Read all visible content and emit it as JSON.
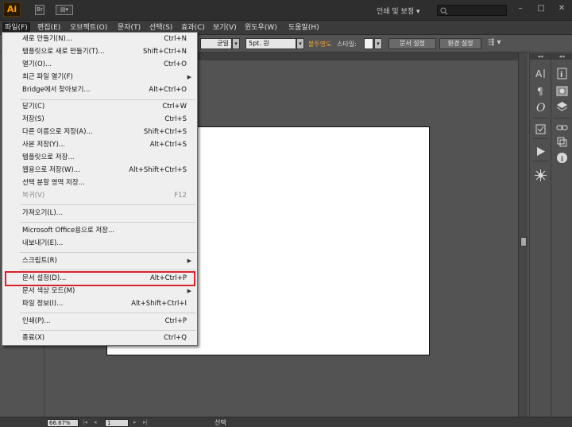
{
  "app": {
    "logo": "Ai",
    "workspace_label": "인쇄 및 보정",
    "search": {
      "value": "",
      "placeholder": ""
    }
  },
  "menubar": [
    "파일(F)",
    "편집(E)",
    "오브젝트(O)",
    "문자(T)",
    "선택(S)",
    "효과(C)",
    "보기(V)",
    "윈도우(W)",
    "도움말(H)"
  ],
  "controlbar": {
    "stroke_profile": "균일",
    "brush": "5pt. 원",
    "opacity_label": "불투명도",
    "style_label": "스타일:",
    "doc_setup_button": "문서 설정",
    "preferences_button": "환경 설정"
  },
  "file_menu": {
    "items": [
      {
        "label": "새로 만들기(N)...",
        "shortcut": "Ctrl+N"
      },
      {
        "label": "템플릿으로 새로 만들기(T)...",
        "shortcut": "Shift+Ctrl+N"
      },
      {
        "label": "열기(O)...",
        "shortcut": "Ctrl+O"
      },
      {
        "label": "최근 파일 열기(F)",
        "shortcut": "",
        "submenu": true
      },
      {
        "label": "Bridge에서 찾아보기...",
        "shortcut": "Alt+Ctrl+O"
      },
      {
        "label": "닫기(C)",
        "shortcut": "Ctrl+W"
      },
      {
        "label": "저장(S)",
        "shortcut": "Ctrl+S"
      },
      {
        "label": "다른 이름으로 저장(A)...",
        "shortcut": "Shift+Ctrl+S"
      },
      {
        "label": "사본 저장(Y)...",
        "shortcut": "Alt+Ctrl+S"
      },
      {
        "label": "템플릿으로 저장...",
        "shortcut": ""
      },
      {
        "label": "웹용으로 저장(W)...",
        "shortcut": "Alt+Shift+Ctrl+S"
      },
      {
        "label": "선택 분할 영역 저장...",
        "shortcut": ""
      },
      {
        "label": "복귀(V)",
        "shortcut": "F12",
        "disabled": true
      },
      {
        "label": "가져오기(L)...",
        "shortcut": ""
      },
      {
        "label": "Microsoft Office용으로 저장...",
        "shortcut": ""
      },
      {
        "label": "내보내기(E)...",
        "shortcut": ""
      },
      {
        "label": "스크립트(R)",
        "shortcut": "",
        "submenu": true
      },
      {
        "label": "문서 설정(D)...",
        "shortcut": "Alt+Ctrl+P"
      },
      {
        "label": "문서 색상 모드(M)",
        "shortcut": "",
        "submenu": true
      },
      {
        "label": "파일 정보(I)...",
        "shortcut": "Alt+Shift+Ctrl+I"
      },
      {
        "label": "인쇄(P)...",
        "shortcut": "Ctrl+P"
      },
      {
        "label": "종료(X)",
        "shortcut": "Ctrl+Q"
      }
    ],
    "highlighted_item": "문서 설정(D)..."
  },
  "statusbar": {
    "zoom": "66.67%",
    "page": "1",
    "status": "선택"
  },
  "dock_left_icons": [
    "character-icon",
    "paragraph-icon",
    "opentype-icon",
    "graphic-styles-icon",
    "appearance-icon",
    "actions-icon",
    "symbols-icon"
  ],
  "dock_right_icons": [
    "info-icon",
    "image-trace-icon",
    "layers-icon",
    "links-icon",
    "transform-icon",
    "align-icon",
    "document-info-icon"
  ],
  "colors": {
    "app_bg": "#535353",
    "menu_bg": "#efefef",
    "highlight_border": "#d9232b",
    "logo_orange": "#ff9a00",
    "opacity_label": "#e8a03a"
  }
}
